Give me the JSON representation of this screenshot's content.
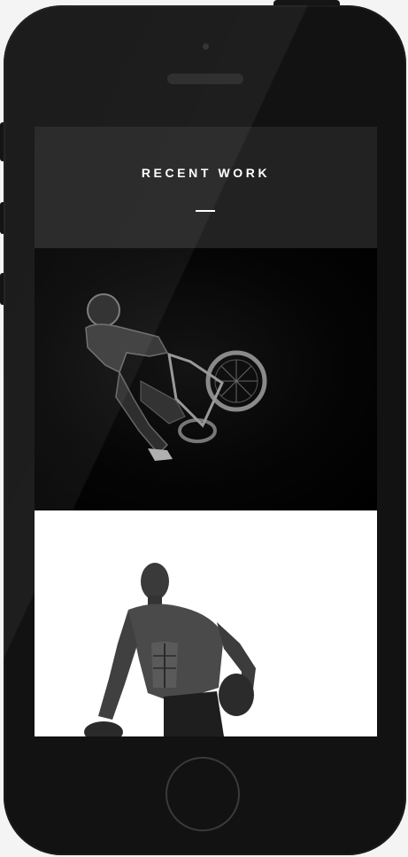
{
  "header": {
    "title": "RECENT WORK"
  },
  "portfolio": {
    "items": [
      {
        "icon": "bmx-rider-photo"
      },
      {
        "icon": "bodybuilder-photo"
      }
    ]
  },
  "colors": {
    "device_body": "#121212",
    "header_bg": "#222222",
    "title_text": "#ffffff",
    "tile_dark_bg": "#000000",
    "tile_light_bg": "#ffffff"
  }
}
